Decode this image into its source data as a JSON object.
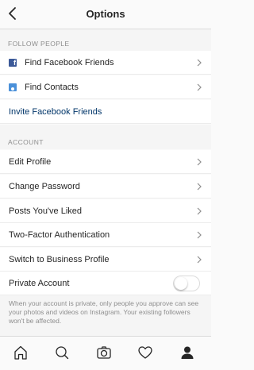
{
  "header": {
    "title": "Options"
  },
  "follow_section": {
    "header": "FOLLOW PEOPLE",
    "items": [
      {
        "label": "Find Facebook Friends",
        "icon": "facebook-icon"
      },
      {
        "label": "Find Contacts",
        "icon": "contacts-icon"
      },
      {
        "label": "Invite Facebook Friends"
      }
    ]
  },
  "account_section": {
    "header": "ACCOUNT",
    "items": [
      {
        "label": "Edit Profile"
      },
      {
        "label": "Change Password"
      },
      {
        "label": "Posts You've Liked"
      },
      {
        "label": "Two-Factor Authentication"
      },
      {
        "label": "Switch to Business Profile"
      }
    ],
    "private_account": {
      "label": "Private Account",
      "enabled": false
    },
    "private_note": "When your account is private, only people you approve can see your photos and videos on Instagram. Your existing followers won't be affected."
  },
  "tabbar": {
    "items": [
      "home-icon",
      "search-icon",
      "camera-icon",
      "heart-icon",
      "profile-icon"
    ],
    "active": "profile-icon"
  },
  "colors": {
    "link": "#003569",
    "facebook": "#3b5998",
    "contacts": "#4a90d9"
  }
}
